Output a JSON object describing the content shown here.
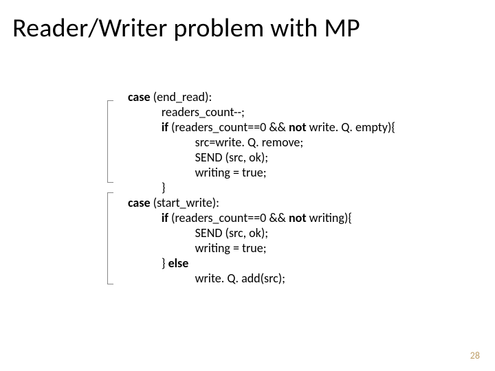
{
  "title": "Reader/Writer problem with MP",
  "page_number": "28",
  "code": {
    "l01a": "case",
    "l01b": " (end_read):",
    "l02": "            readers_count--;",
    "l03a": "            ",
    "l03b": "if",
    "l03c": " (readers_count==0 && ",
    "l03d": "not",
    "l03e": " write. Q. empty){",
    "l04": "                        src=write. Q. remove;",
    "l05": "                        SEND (src, ok);",
    "l06": "                        writing = true;",
    "l07": "            }",
    "l08a": "case",
    "l08b": " (start_write):",
    "l09a": "            ",
    "l09b": "if",
    "l09c": " (readers_count==0 && ",
    "l09d": "not",
    "l09e": " writing){",
    "l10": "                        SEND (src, ok);",
    "l11": "                        writing = true;",
    "l12a": "            } ",
    "l12b": "else",
    "l13": "                        write. Q. add(src);"
  }
}
